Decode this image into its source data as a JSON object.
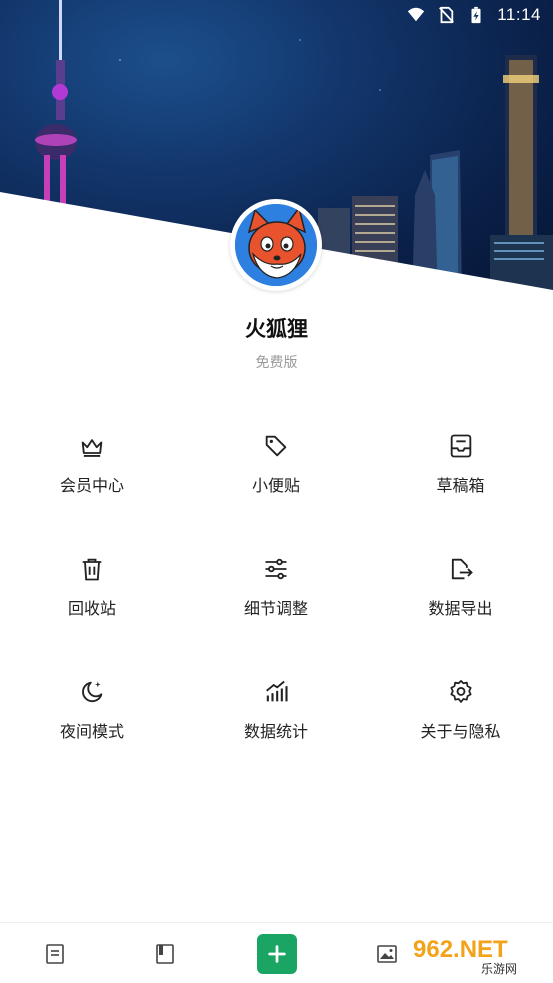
{
  "status_bar": {
    "time": "11:14"
  },
  "profile": {
    "name": "火狐狸",
    "plan": "免费版"
  },
  "menu": [
    {
      "label": "会员中心",
      "icon": "crown-icon"
    },
    {
      "label": "小便贴",
      "icon": "tag-icon"
    },
    {
      "label": "草稿箱",
      "icon": "inbox-icon"
    },
    {
      "label": "回收站",
      "icon": "trash-icon"
    },
    {
      "label": "细节调整",
      "icon": "sliders-icon"
    },
    {
      "label": "数据导出",
      "icon": "export-icon"
    },
    {
      "label": "夜间模式",
      "icon": "moon-icon"
    },
    {
      "label": "数据统计",
      "icon": "stats-icon"
    },
    {
      "label": "关于与隐私",
      "icon": "settings-icon"
    }
  ],
  "bottom_nav": {
    "tabs": [
      "notes-icon",
      "notebook-icon",
      "add-icon",
      "image-icon"
    ],
    "accent": "#1aa565"
  },
  "watermark": {
    "text": "962.NET",
    "subtext": "乐游网"
  }
}
